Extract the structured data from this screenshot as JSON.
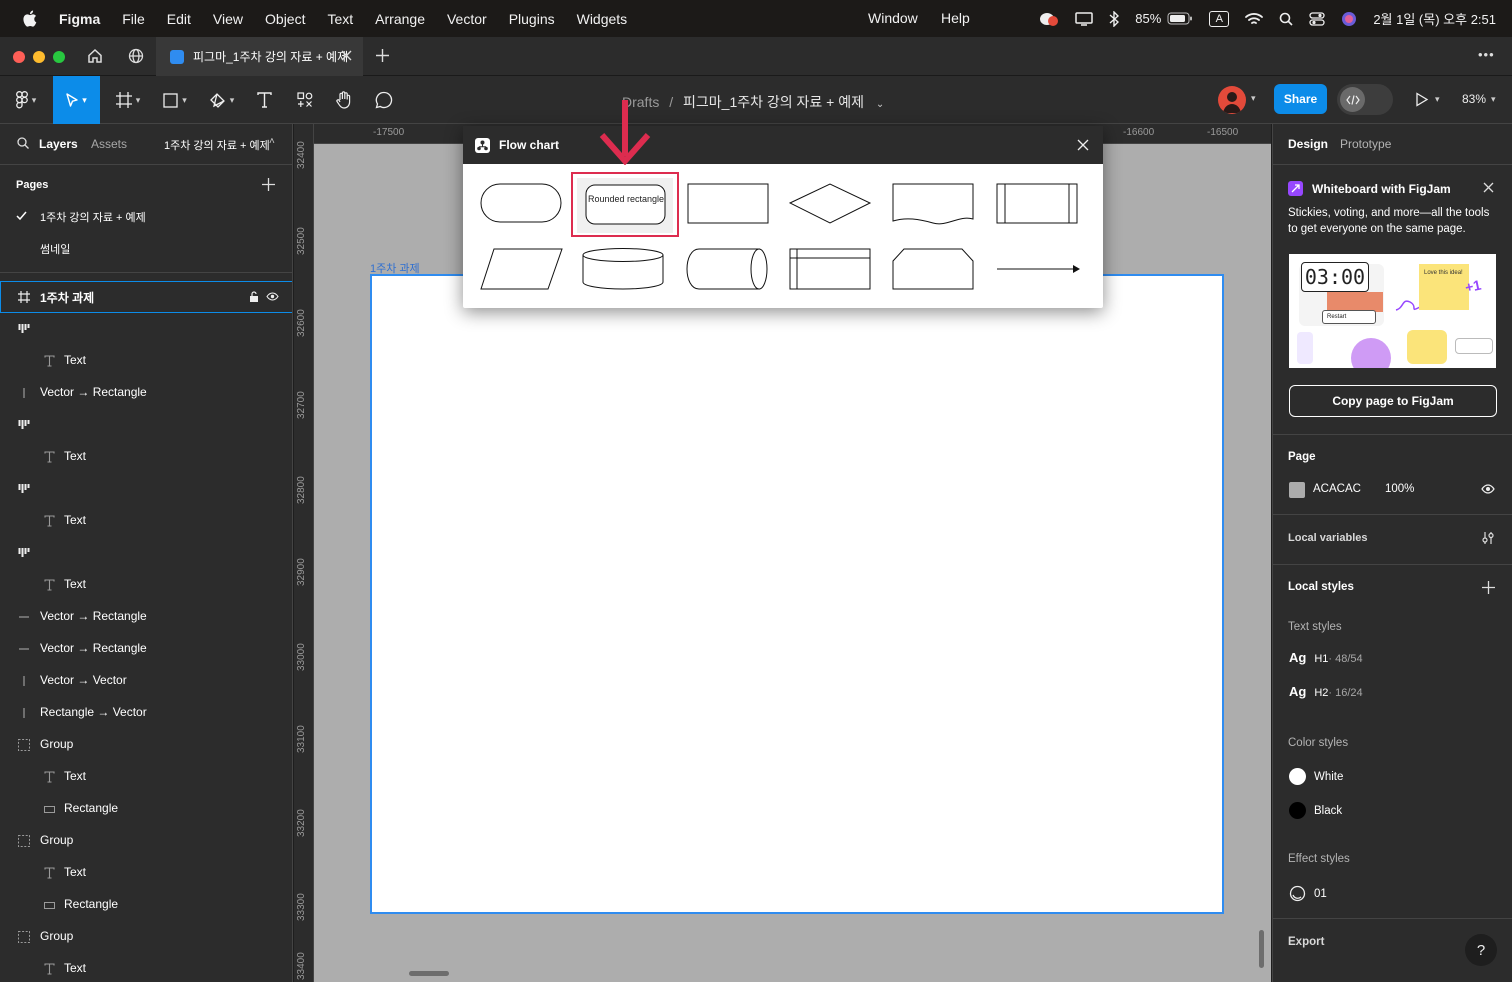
{
  "menubar": {
    "app": "Figma",
    "items": [
      "File",
      "Edit",
      "View",
      "Object",
      "Text",
      "Arrange",
      "Vector",
      "Plugins",
      "Widgets"
    ],
    "window": "Window",
    "help": "Help",
    "battery": "85%",
    "input_source": "A",
    "clock": "2월 1일 (목) 오후 2:51"
  },
  "tabbar": {
    "active_tab": "피그마_1주차 강의 자료 + 예제",
    "more": "•••"
  },
  "toolbar": {
    "breadcrumb_root": "Drafts",
    "breadcrumb_sep": "/",
    "file_name": "피그마_1주차 강의 자료 + 예제",
    "share_label": "Share",
    "zoom": "83%"
  },
  "left_panel": {
    "tab_layers": "Layers",
    "tab_assets": "Assets",
    "page_switch": "1주차 강의 자료 + 예제",
    "pages_title": "Pages",
    "pages": [
      "1주차 강의 자료 + 예제",
      "썸네일"
    ],
    "layers": [
      {
        "label": "1주차 과제",
        "icon": "frame-icon",
        "indent": 0
      },
      {
        "label": "",
        "icon": "component-icon",
        "indent": 0
      },
      {
        "label": "Text",
        "icon": "text-icon",
        "indent": 1
      },
      {
        "label": "Vector → Rectangle",
        "icon": "vector-icon",
        "indent": 0
      },
      {
        "label": "",
        "icon": "component-icon",
        "indent": 0
      },
      {
        "label": "Text",
        "icon": "text-icon",
        "indent": 1
      },
      {
        "label": "",
        "icon": "component-icon",
        "indent": 0
      },
      {
        "label": "Text",
        "icon": "text-icon",
        "indent": 1
      },
      {
        "label": "",
        "icon": "component-icon",
        "indent": 0
      },
      {
        "label": "Text",
        "icon": "text-icon",
        "indent": 1
      },
      {
        "label": "Vector → Rectangle",
        "icon": "line-icon",
        "indent": 0
      },
      {
        "label": "Vector → Rectangle",
        "icon": "line-icon",
        "indent": 0
      },
      {
        "label": "Vector → Vector",
        "icon": "vector-icon",
        "indent": 0
      },
      {
        "label": "Rectangle → Vector",
        "icon": "vector-icon",
        "indent": 0
      },
      {
        "label": "Group",
        "icon": "group-icon",
        "indent": 0
      },
      {
        "label": "Text",
        "icon": "text-icon",
        "indent": 1
      },
      {
        "label": "Rectangle",
        "icon": "rectangle-icon",
        "indent": 1
      },
      {
        "label": "Group",
        "icon": "group-icon",
        "indent": 0
      },
      {
        "label": "Text",
        "icon": "text-icon",
        "indent": 1
      },
      {
        "label": "Rectangle",
        "icon": "rectangle-icon",
        "indent": 1
      },
      {
        "label": "Group",
        "icon": "group-icon",
        "indent": 0
      },
      {
        "label": "Text",
        "icon": "text-icon",
        "indent": 1
      }
    ]
  },
  "canvas": {
    "ruler_top": [
      "-17500",
      "-16600",
      "-16500"
    ],
    "ruler_left": [
      "32400",
      "32500",
      "32600",
      "32700",
      "32800",
      "32900",
      "33000",
      "33100",
      "33200",
      "33300",
      "33400"
    ],
    "frame_label": "1주차 과제",
    "background": "#adadad"
  },
  "flow_chart": {
    "title": "Flow chart",
    "highlight_label": "Rounded rectangle",
    "highlight_color": "#dd2c4f",
    "shapes": [
      "terminal",
      "rounded-rectangle",
      "process",
      "decision",
      "document",
      "predefined-process",
      "data",
      "database",
      "direct-access-storage",
      "internal-storage",
      "manual-operation",
      "arrow"
    ]
  },
  "right_panel": {
    "tab_design": "Design",
    "tab_prototype": "Prototype",
    "promo_title": "Whiteboard with FigJam",
    "promo_body": "Stickies, voting, and more—all the tools to get everyone on the same page.",
    "promo_timer": "03:00",
    "promo_sticky": "Love this idea!",
    "promo_plus": "+1",
    "promo_restart": "Restart",
    "copy_button": "Copy page to FigJam",
    "page_title": "Page",
    "page_color": "ACACAC",
    "page_opacity": "100%",
    "local_variables": "Local variables",
    "local_styles": "Local styles",
    "text_styles_title": "Text styles",
    "text_styles": [
      {
        "ag": "Ag",
        "name": "H1",
        "spec": " · 48/54"
      },
      {
        "ag": "Ag",
        "name": "H2",
        "spec": " · 16/24"
      }
    ],
    "color_styles_title": "Color styles",
    "color_styles": [
      {
        "name": "White",
        "color": "#ffffff"
      },
      {
        "name": "Black",
        "color": "#000000"
      }
    ],
    "effect_styles_title": "Effect styles",
    "effect_style": "01",
    "export": "Export",
    "help": "?"
  },
  "colors": {
    "accent": "#0c8ce9",
    "frame_border": "#2f8cf0",
    "panel": "#2c2c2c",
    "menubar": "#1c1a18"
  }
}
